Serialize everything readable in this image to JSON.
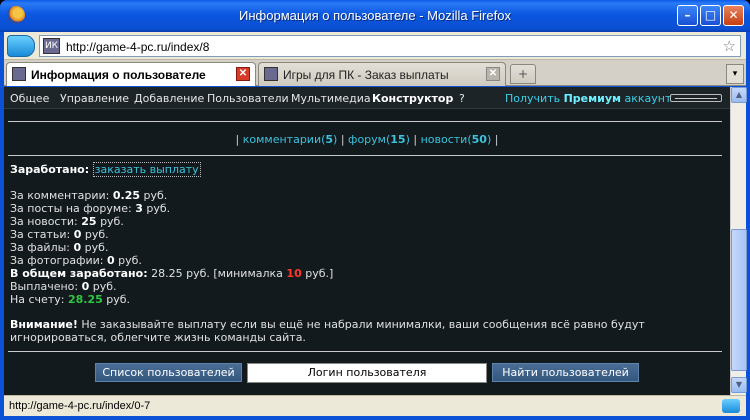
{
  "window": {
    "title": "Информация о пользователе - Mozilla Firefox"
  },
  "address_bar": {
    "url": "http://game-4-pc.ru/index/8",
    "site_icon_text": "ИК"
  },
  "tabs": [
    {
      "label": "Информация о пользователе",
      "active": true
    },
    {
      "label": "Игры для ПК - Заказ выплаты",
      "active": false
    }
  ],
  "site_nav": {
    "items": [
      "Общее",
      "Управление",
      "Добавление",
      "Пользователи",
      "Мультимедиа",
      "Конструктор",
      "?"
    ],
    "premium_prefix": "Получить",
    "premium_bold": "Премиум",
    "premium_suffix": "аккаунт"
  },
  "counts": {
    "comments_label": "комментарии",
    "comments_count": "5",
    "forum_label": "форум",
    "forum_count": "15",
    "news_label": "новости",
    "news_count": "50"
  },
  "earnings": {
    "heading": "Заработано:",
    "order_link": "заказать выплату",
    "lines": [
      {
        "label": "За комментарии:",
        "value": "0.25",
        "unit": "руб."
      },
      {
        "label": "За посты на форуме:",
        "value": "3",
        "unit": "руб."
      },
      {
        "label": "За новости:",
        "value": "25",
        "unit": "руб."
      },
      {
        "label": "За статьи:",
        "value": "0",
        "unit": "руб."
      },
      {
        "label": "За файлы:",
        "value": "0",
        "unit": "руб."
      },
      {
        "label": "За фотографии:",
        "value": "0",
        "unit": "руб."
      }
    ],
    "total_label": "В общем заработано:",
    "total_value": "28.25 руб.",
    "minimum_prefix": "[минималка",
    "minimum_value": "10",
    "minimum_suffix": "руб.]",
    "paid_label": "Выплачено:",
    "paid_value": "0",
    "paid_unit": "руб.",
    "balance_label": "На счету:",
    "balance_value": "28.25",
    "balance_unit": "руб."
  },
  "notice": {
    "bold": "Внимание!",
    "text": "Не заказывайте выплату если вы ещё не набрали минималки, ваши сообщения всё равно будут игнорироваться, облегчите жизнь команды сайта."
  },
  "search": {
    "list_button": "Список пользователей",
    "input_value": "Логин пользователя",
    "find_button": "Найти пользователей"
  },
  "status_bar": {
    "text": "http://game-4-pc.ru/index/0-7"
  },
  "colors": {
    "link": "#3cc3dc",
    "red": "#ff3a2a",
    "green": "#2ec640",
    "page_bg": "#121a1e"
  }
}
